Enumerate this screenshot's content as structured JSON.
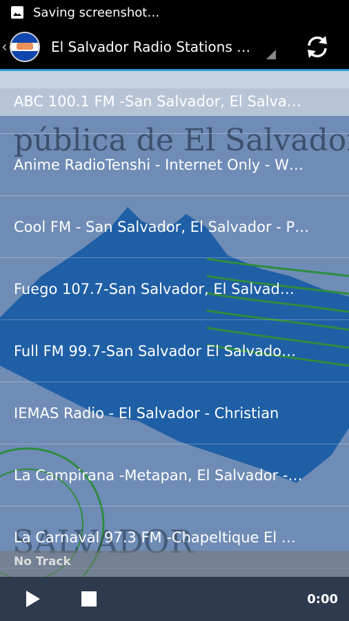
{
  "status_bar": {
    "notification_text": "Saving screenshot…"
  },
  "action_bar": {
    "title": "El Salvador Radio Stations A…"
  },
  "background": {
    "headline": "pública de El Salvador",
    "footer_word": "SALVADOR"
  },
  "stations": [
    {
      "name": "ABC 100.1 FM  -San Salvador, El Salva…"
    },
    {
      "name": "Anime RadioTenshi - Internet Only - W…"
    },
    {
      "name": "Cool FM - San Salvador, El Salvador - P…"
    },
    {
      "name": "Fuego 107.7-San Salvador, El Salvad…"
    },
    {
      "name": "Full FM 99.7-San Salvador El Salvado…"
    },
    {
      "name": "IEMAS Radio - El Salvador - Christian"
    },
    {
      "name": "La Campirana -Metapan, El Salvador  -…"
    },
    {
      "name": "La Carnaval 97.3 FM -Chapeltique El …"
    }
  ],
  "player": {
    "track": "No Track",
    "time": "0:00"
  },
  "colors": {
    "accent": "#2a9fd6",
    "map_blue": "#1f5fa6",
    "background": "#6f8cb6"
  }
}
